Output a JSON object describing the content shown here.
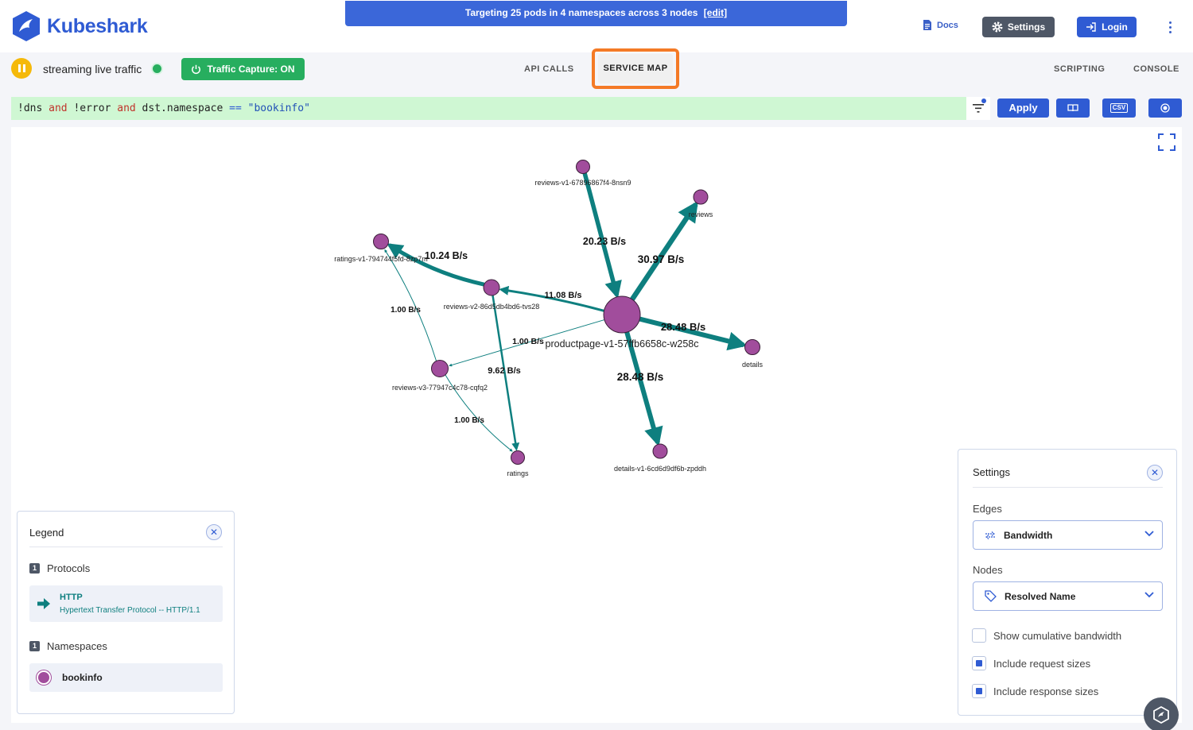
{
  "app": {
    "name": "Kubeshark"
  },
  "banner": {
    "text": "Targeting 25 pods in 4 namespaces across 3 nodes",
    "edit_label": "[edit]"
  },
  "header": {
    "docs_label": "Docs",
    "settings_label": "Settings",
    "login_label": "Login"
  },
  "toolbar": {
    "streaming_label": "streaming live traffic",
    "capture_label": "Traffic Capture: ON",
    "tabs": {
      "api_calls": "API CALLS",
      "service_map": "SERVICE MAP",
      "scripting": "SCRIPTING",
      "console": "CONSOLE"
    }
  },
  "filter": {
    "parts": [
      "!dns ",
      "and",
      " !error ",
      "and",
      " dst.namespace ",
      "==",
      " ",
      "\"bookinfo\""
    ],
    "apply_label": "Apply",
    "csv_label": "CSV"
  },
  "graph": {
    "nodes": [
      {
        "id": "productpage",
        "label": "productpage-v1-57ffb6658c-w258c"
      },
      {
        "id": "reviews-v1",
        "label": "reviews-v1-67896867f4-8nsn9"
      },
      {
        "id": "reviews",
        "label": "reviews"
      },
      {
        "id": "ratings-v1",
        "label": "ratings-v1-794744f5fd-8zp7m"
      },
      {
        "id": "reviews-v2",
        "label": "reviews-v2-86d5db4bd6-tvs28"
      },
      {
        "id": "reviews-v3",
        "label": "reviews-v3-77947c4c78-cqfq2"
      },
      {
        "id": "details",
        "label": "details"
      },
      {
        "id": "details-v1",
        "label": "details-v1-6cd6d9df6b-zpddh"
      },
      {
        "id": "ratings",
        "label": "ratings"
      }
    ],
    "edges": [
      {
        "from": "reviews-v1",
        "to": "productpage",
        "label": "20.23 B/s"
      },
      {
        "from": "productpage",
        "to": "reviews",
        "label": "30.97 B/s"
      },
      {
        "from": "reviews-v2",
        "to": "ratings-v1",
        "label": "10.24 B/s"
      },
      {
        "from": "productpage",
        "to": "reviews-v2",
        "label": "11.08 B/s"
      },
      {
        "from": "productpage",
        "to": "details",
        "label": "28.48 B/s"
      },
      {
        "from": "productpage",
        "to": "details-v1",
        "label": "28.48 B/s"
      },
      {
        "from": "reviews-v3",
        "to": "ratings-v1",
        "label": "1.00 B/s"
      },
      {
        "from": "productpage",
        "to": "reviews-v3",
        "label": "1.00 B/s"
      },
      {
        "from": "reviews-v2",
        "to": "ratings",
        "label": "9.62 B/s"
      },
      {
        "from": "reviews-v3",
        "to": "ratings",
        "label": "1.00 B/s"
      }
    ]
  },
  "legend": {
    "title": "Legend",
    "protocols_count": "1",
    "protocols_label": "Protocols",
    "protocol_name": "HTTP",
    "protocol_desc": "Hypertext Transfer Protocol -- HTTP/1.1",
    "namespaces_count": "1",
    "namespaces_label": "Namespaces",
    "namespace_name": "bookinfo",
    "namespace_color": "#a14d9c"
  },
  "settings_panel": {
    "title": "Settings",
    "edges_label": "Edges",
    "edges_value": "Bandwidth",
    "nodes_label": "Nodes",
    "nodes_value": "Resolved Name",
    "checks": [
      {
        "label": "Show cumulative bandwidth",
        "checked": false
      },
      {
        "label": "Include request sizes",
        "checked": true
      },
      {
        "label": "Include response sizes",
        "checked": true
      }
    ]
  },
  "colors": {
    "accent": "#2f5bd3",
    "edge": "#0e7f7f",
    "node": "#a14d9c",
    "capture": "#27ae5f",
    "highlight": "#f47a26"
  }
}
